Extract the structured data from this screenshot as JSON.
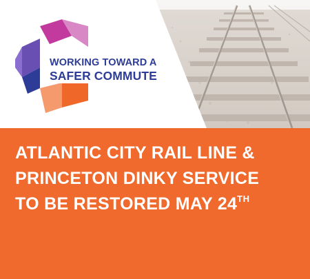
{
  "logo": {
    "line1": "WORKING TOWARD A",
    "line2": "SAFER COMMUTE",
    "colors": {
      "magenta": "#c23a9d",
      "pink": "#d988c6",
      "violet": "#6a4fb2",
      "navy": "#2d3c96",
      "orange": "#f0672a",
      "peach": "#f59a6c"
    }
  },
  "photo": {
    "subject": "railroad-tracks"
  },
  "headline": {
    "line1": "ATLANTIC CITY RAIL LINE &",
    "line2": "PRINCETON DINKY SERVICE",
    "line3": "TO BE RESTORED MAY 24",
    "line3_suffix": "TH"
  },
  "colors": {
    "band": "#ef6a2c",
    "headline_text": "#ffffff",
    "top_background": "#ffffff"
  }
}
